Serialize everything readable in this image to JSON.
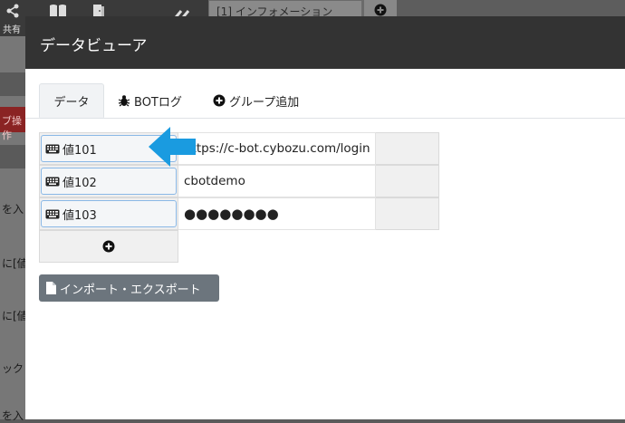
{
  "background": {
    "share_label": "共有",
    "tab_title": "[1] インフォメーション",
    "tab_add_icon": "plus-circle-icon",
    "row_fragments": [
      "を入",
      "に[値",
      "に[値",
      "ック",
      "を入"
    ],
    "red_fragment": "ブ操作",
    "icons": [
      "share-icon",
      "book-icon",
      "door-icon",
      "collapse-icon"
    ]
  },
  "modal": {
    "title": "データビューア",
    "tabs": [
      {
        "label": "データ",
        "active": true,
        "icon": ""
      },
      {
        "label": "BOTログ",
        "active": false,
        "icon": "bug-icon"
      },
      {
        "label": "グループ追加",
        "active": false,
        "icon": "plus-circle-icon"
      }
    ],
    "variables": [
      {
        "name": "値101",
        "value": "https://c-bot.cybozu.com/login",
        "icon": "keyboard-icon"
      },
      {
        "name": "値102",
        "value": "cbotdemo",
        "icon": "keyboard-icon"
      },
      {
        "name": "値103",
        "value": "●●●●●●●●",
        "icon": "keyboard-icon"
      }
    ],
    "add_variable_icon": "plus-circle-icon",
    "import_export_label": "インポート・エクスポート",
    "import_export_icon": "file-icon"
  },
  "colors": {
    "header": "#333333",
    "arrow": "#1a9be0",
    "secondary_button": "#6c757d"
  }
}
